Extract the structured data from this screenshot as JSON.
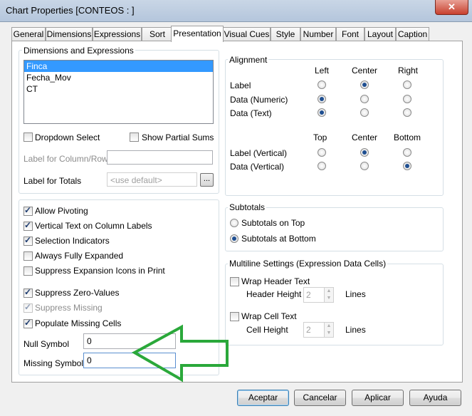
{
  "window": {
    "title": "Chart Properties [CONTEOS : ]",
    "close_glyph": "✕"
  },
  "tabs": [
    "General",
    "Dimensions",
    "Expressions",
    "Sort",
    "Presentation",
    "Visual Cues",
    "Style",
    "Number",
    "Font",
    "Layout",
    "Caption"
  ],
  "active_tab": "Presentation",
  "dims_expr": {
    "label": "Dimensions and Expressions",
    "items": [
      "Finca",
      "Fecha_Mov",
      "CT"
    ],
    "selected": "Finca"
  },
  "dropdown_select": {
    "label": "Dropdown Select",
    "checked": false
  },
  "show_partial_sums": {
    "label": "Show Partial Sums",
    "checked": false
  },
  "label_for_column_row": {
    "label": "Label for Column/Row",
    "value": ""
  },
  "label_for_totals": {
    "label": "Label for Totals",
    "placeholder": "<use default>",
    "button": "..."
  },
  "alignment": {
    "label": "Alignment",
    "headers_h": [
      "Left",
      "Center",
      "Right"
    ],
    "rows_h": [
      {
        "label": "Label",
        "selected": "Center"
      },
      {
        "label": "Data (Numeric)",
        "selected": "Left"
      },
      {
        "label": "Data (Text)",
        "selected": "Left"
      }
    ],
    "headers_v": [
      "Top",
      "Center",
      "Bottom"
    ],
    "rows_v": [
      {
        "label": "Label (Vertical)",
        "selected": "Center"
      },
      {
        "label": "Data (Vertical)",
        "selected": "Bottom"
      }
    ]
  },
  "options": [
    {
      "label": "Allow Pivoting",
      "checked": true,
      "disabled": false
    },
    {
      "label": "Vertical Text on Column Labels",
      "checked": true,
      "disabled": false
    },
    {
      "label": "Selection Indicators",
      "checked": true,
      "disabled": false
    },
    {
      "label": "Always Fully Expanded",
      "checked": false,
      "disabled": false
    },
    {
      "label": "Suppress Expansion Icons in Print",
      "checked": false,
      "disabled": false
    },
    {
      "label": "Suppress Zero-Values",
      "checked": true,
      "disabled": false
    },
    {
      "label": "Suppress Missing",
      "checked": true,
      "disabled": true
    },
    {
      "label": "Populate Missing Cells",
      "checked": true,
      "disabled": false
    }
  ],
  "null_symbol": {
    "label": "Null Symbol",
    "value": "0"
  },
  "missing_symbol": {
    "label": "Missing Symbol",
    "value": "0"
  },
  "subtotals": {
    "label": "Subtotals",
    "options": [
      "Subtotals on Top",
      "Subtotals at Bottom"
    ],
    "selected": "Subtotals at Bottom"
  },
  "multiline": {
    "label": "Multiline Settings (Expression Data Cells)",
    "wrap_header": {
      "label": "Wrap Header Text",
      "checked": false
    },
    "header_height": {
      "label": "Header Height",
      "value": "2",
      "unit": "Lines"
    },
    "wrap_cell": {
      "label": "Wrap Cell Text",
      "checked": false
    },
    "cell_height": {
      "label": "Cell Height",
      "value": "2",
      "unit": "Lines"
    }
  },
  "buttons": {
    "ok": "Aceptar",
    "cancel": "Cancelar",
    "apply": "Aplicar",
    "help": "Ayuda"
  },
  "colors": {
    "annotation_arrow": "#2aa83a",
    "selection": "#3399ff"
  }
}
